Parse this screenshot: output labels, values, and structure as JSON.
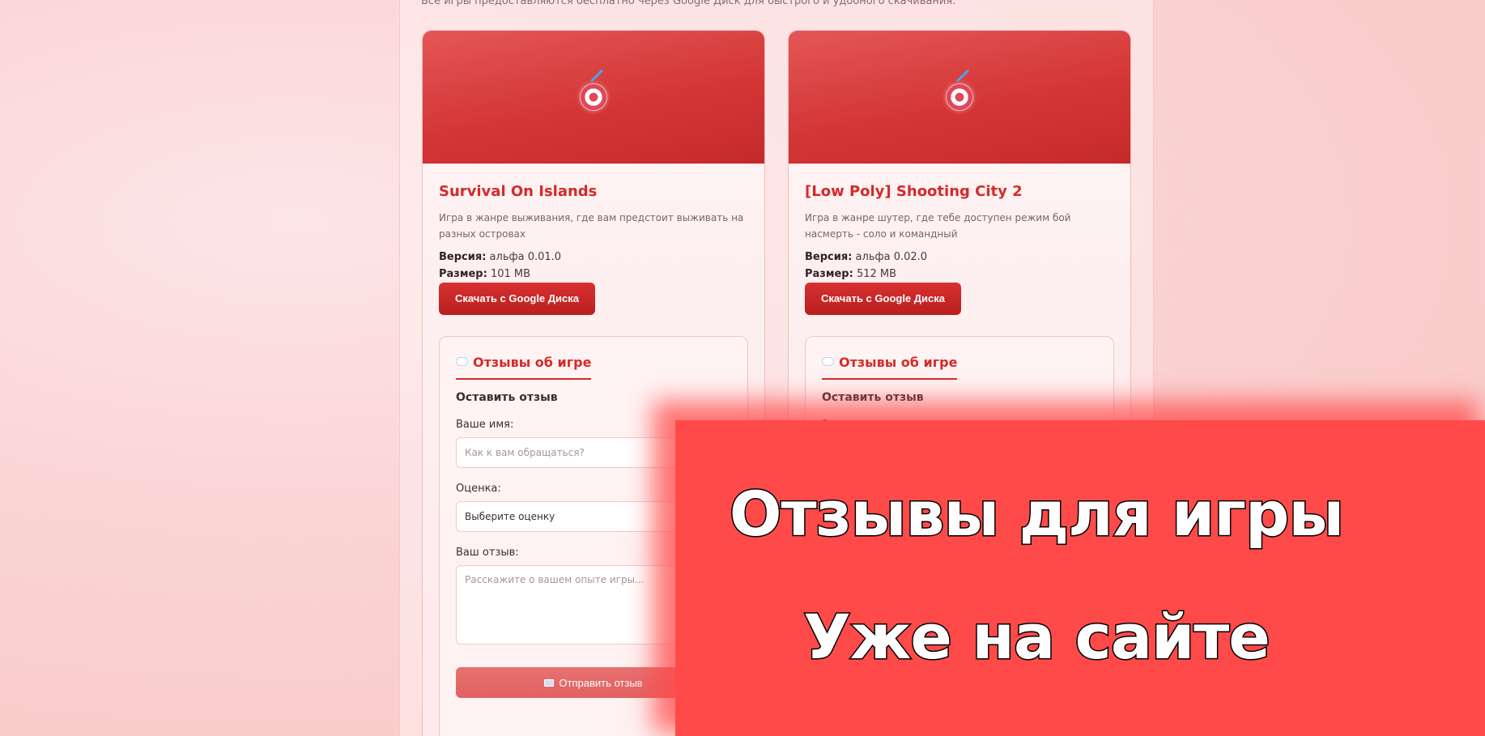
{
  "intro_text": "Все игры предоставляются бесплатно через Google Диск для быстрого и удобного скачивания.",
  "games": [
    {
      "title": "Survival On Islands",
      "description": "Игра в жанре выживания, где вам предстоит выживать на разных островах",
      "version_label": "Версия:",
      "version": "альфа 0.01.0",
      "size_label": "Размер:",
      "size": "101 MB",
      "download_label": "Скачать с Google Диска",
      "icon": "target-icon"
    },
    {
      "title": "[Low Poly] Shooting City 2",
      "description": "Игра в жанре шутер, где тебе доступен режим бой насмерть - соло и командный",
      "version_label": "Версия:",
      "version": "альфа 0.02.0",
      "size_label": "Размер:",
      "size": "512 MB",
      "download_label": "Скачать с Google Диска",
      "icon": "target-icon"
    }
  ],
  "reviews": {
    "header": "Отзывы об игре",
    "leave_title": "Оставить отзыв",
    "name_label": "Ваше имя:",
    "name_placeholder": "Как к вам обращаться?",
    "rating_label": "Оценка:",
    "rating_selected": "Выберите оценку",
    "review_label": "Ваш отзыв:",
    "review_placeholder": "Расскажите о вашем опыте игры...",
    "submit_label": "Отправить отзыв"
  },
  "promo": {
    "line1": "Отзывы для игры",
    "line2": "Уже на сайте"
  },
  "colors": {
    "accent": "#d42a2a",
    "overlay": "#ff4a4a",
    "background": "#fbd4d4"
  }
}
